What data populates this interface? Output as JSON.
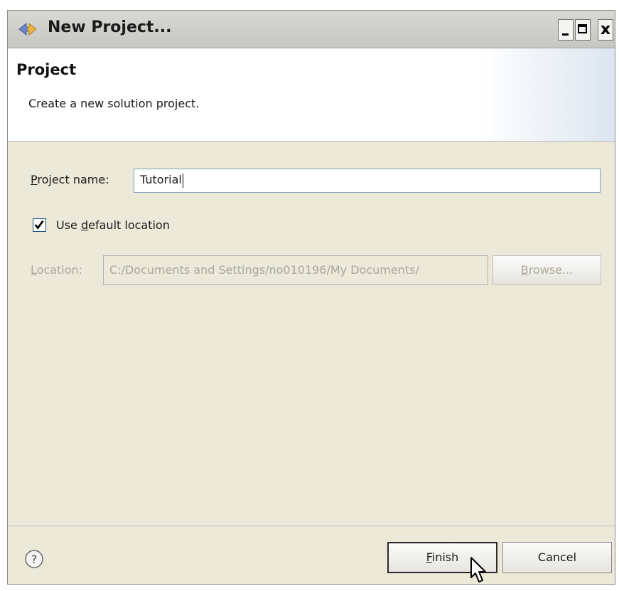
{
  "window": {
    "title": "New Project...",
    "minimize_symbol": "_",
    "maximize_symbol": "□",
    "close_symbol": "x"
  },
  "banner": {
    "title": "Project",
    "description": "Create a new solution project."
  },
  "form": {
    "project_name_label": "Project name:",
    "project_name_value": "Tutorial",
    "default_location_label": "Use default location",
    "default_location_checked": true,
    "location_label": "Location:",
    "location_value": "C:/Documents and Settings/no010196/My Documents/",
    "browse_label": "Browse..."
  },
  "footer": {
    "help_symbol": "?",
    "finish_label": "Finish",
    "cancel_label": "Cancel"
  },
  "icons": {
    "title_icon": "eclipse-project-arrows-icon",
    "help_icon": "help-circle-icon",
    "checkmark": "checkmark-icon",
    "cursor": "mouse-pointer-icon"
  },
  "colors": {
    "titlebar": "#c6c6c2",
    "dialog_bg": "#ece9d8",
    "banner_bg": "#ffffff",
    "disabled_text": "#aca899",
    "input_border": "#7f9db9"
  }
}
